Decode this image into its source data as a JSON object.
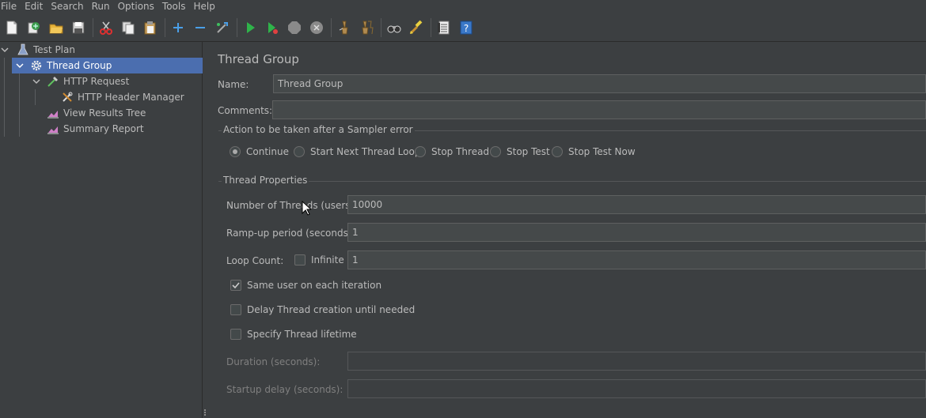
{
  "menu": [
    "File",
    "Edit",
    "Search",
    "Run",
    "Options",
    "Tools",
    "Help"
  ],
  "toolbar": {
    "buttons": [
      "new-icon",
      "templates-icon",
      "open-icon",
      "save-icon",
      "cut-icon",
      "copy-icon",
      "paste-icon",
      "expand-icon",
      "collapse-icon",
      "toggle-icon",
      "start-icon",
      "start-no-pauses-icon",
      "stop-icon",
      "shutdown-icon",
      "clear-icon",
      "clear-all-icon",
      "search-icon",
      "reset-search-icon",
      "function-helper-icon",
      "help-icon"
    ]
  },
  "tree": {
    "items": [
      {
        "label": "Test Plan",
        "icon": "test-plan-icon"
      },
      {
        "label": "Thread Group",
        "icon": "gear-icon"
      },
      {
        "label": "HTTP Request",
        "icon": "pipette-icon"
      },
      {
        "label": "HTTP Header Manager",
        "icon": "tools-icon"
      },
      {
        "label": "View Results Tree",
        "icon": "chart-icon"
      },
      {
        "label": "Summary Report",
        "icon": "chart-icon"
      }
    ]
  },
  "panel": {
    "title": "Thread Group",
    "name_label": "Name:",
    "name_value": "Thread Group",
    "comments_label": "Comments:",
    "comments_value": "",
    "sampler_error": {
      "title": "Action to be taken after a Sampler error",
      "options": [
        "Continue",
        "Start Next Thread Loop",
        "Stop Thread",
        "Stop Test",
        "Stop Test Now"
      ],
      "selected": "Continue"
    },
    "thread_props": {
      "title": "Thread Properties",
      "threads_label": "Number of Threads (users):",
      "threads_value": "10000",
      "rampup_label": "Ramp-up period (seconds):",
      "rampup_value": "1",
      "loop_label": "Loop Count:",
      "infinite_label": "Infinite",
      "loop_value": "1",
      "same_user_label": "Same user on each iteration",
      "delay_label": "Delay Thread creation until needed",
      "lifetime_label": "Specify Thread lifetime",
      "duration_label": "Duration (seconds):",
      "duration_value": "",
      "startup_label": "Startup delay (seconds):",
      "startup_value": ""
    }
  }
}
